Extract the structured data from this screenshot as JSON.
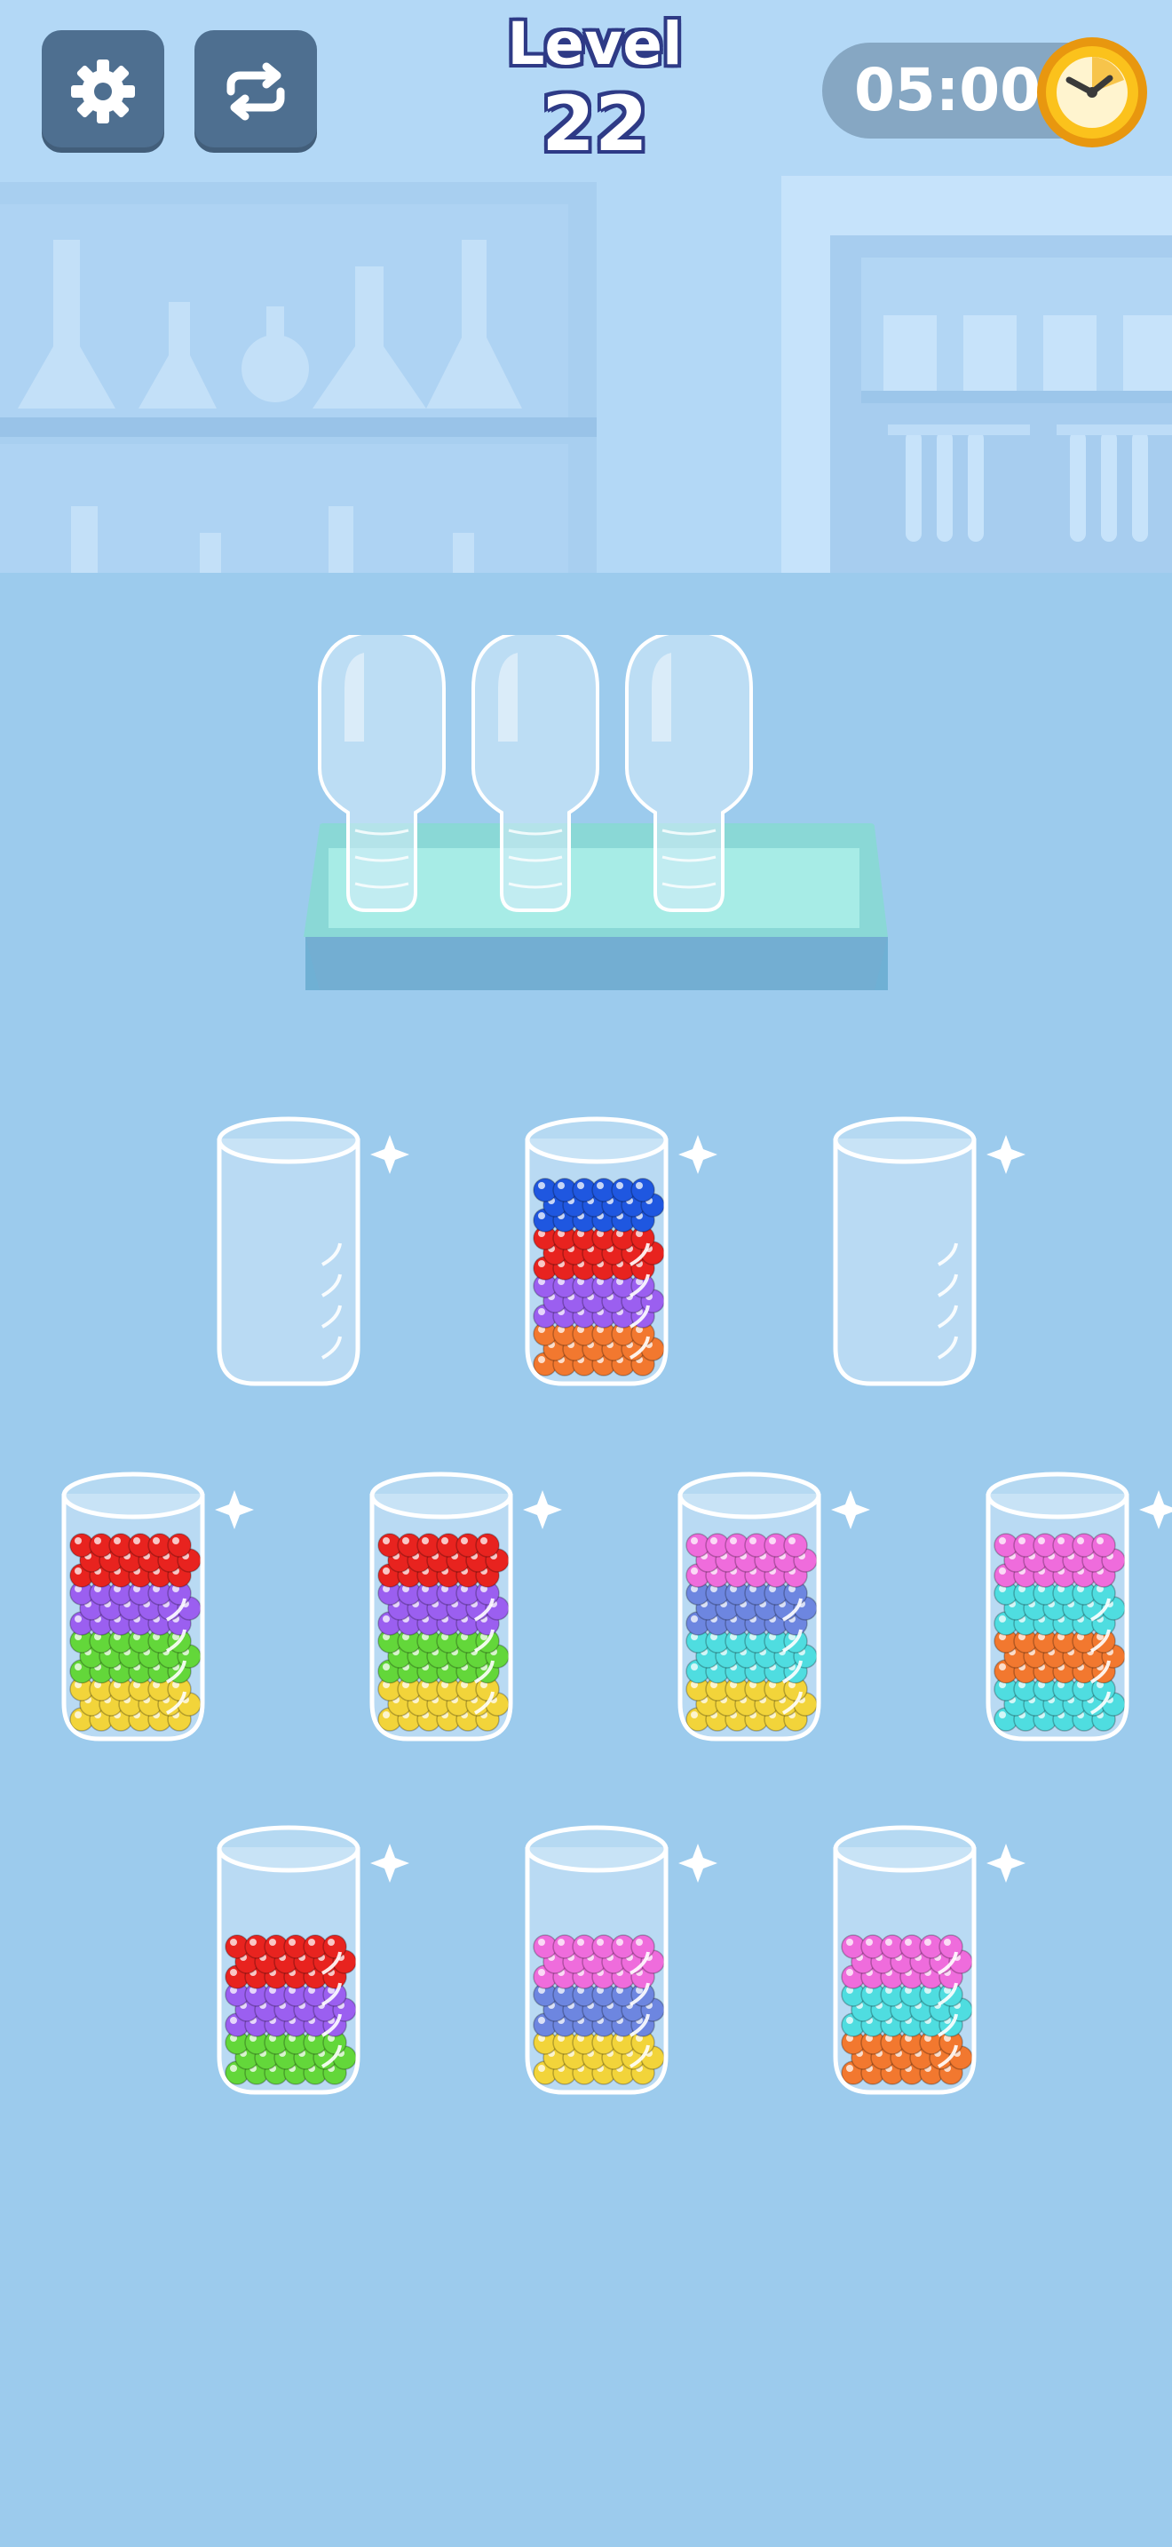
{
  "hud": {
    "level_label": "Level",
    "level_number": "22",
    "timer": "05:00",
    "settings_icon": "gear-icon",
    "restart_icon": "repeat-icon",
    "timer_icon": "stopwatch-icon"
  },
  "colors": {
    "red": "#e8231f",
    "blue": "#1f57e0",
    "purple": "#9b5ff0",
    "orange": "#f2782f",
    "green": "#63d73a",
    "yellow": "#f2d43a",
    "pink": "#ef6cdc",
    "cyan": "#4fdde0",
    "slate": "#6d86e0"
  },
  "helper_slots": [
    {
      "state": "empty"
    },
    {
      "state": "empty"
    },
    {
      "state": "empty"
    }
  ],
  "tubes": [
    {
      "row": 1,
      "layers": []
    },
    {
      "row": 1,
      "layers": [
        "orange",
        "purple",
        "red",
        "blue"
      ]
    },
    {
      "row": 1,
      "layers": []
    },
    {
      "row": 2,
      "layers": [
        "yellow",
        "green",
        "purple",
        "red"
      ]
    },
    {
      "row": 2,
      "layers": [
        "yellow",
        "green",
        "purple",
        "red"
      ]
    },
    {
      "row": 2,
      "layers": [
        "yellow",
        "cyan",
        "slate",
        "pink"
      ]
    },
    {
      "row": 2,
      "layers": [
        "cyan",
        "orange",
        "cyan",
        "pink"
      ]
    },
    {
      "row": 3,
      "layers": [
        "green",
        "purple",
        "red"
      ]
    },
    {
      "row": 3,
      "layers": [
        "yellow",
        "slate",
        "pink"
      ]
    },
    {
      "row": 3,
      "layers": [
        "orange",
        "cyan",
        "pink"
      ]
    }
  ]
}
